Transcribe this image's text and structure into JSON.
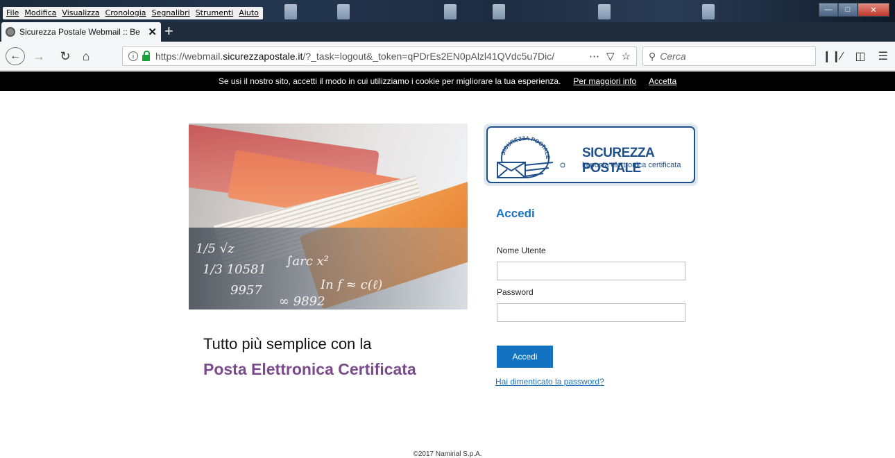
{
  "browser": {
    "menu": [
      "File",
      "Modifica",
      "Visualizza",
      "Cronologia",
      "Segnalibri",
      "Strumenti",
      "Aiuto"
    ],
    "tab_title": "Sicurezza Postale Webmail :: Be",
    "url_prefix": "https://webmail.",
    "url_domain": "sicurezzapostale.it",
    "url_rest": "/?_task=logout&_token=qPDrEs2EN0pAlzl41QVdc5u7Dic/",
    "search_placeholder": "Cerca"
  },
  "cookie": {
    "text": "Se usi il nostro sito, accetti il modo in cui utilizziamo i cookie per migliorare la tua esperienza.",
    "more_link": "Per maggiori info",
    "accept_link": "Accetta"
  },
  "hero": {
    "tagline_line1": "Tutto più semplice con la",
    "tagline_line2": "Posta Elettronica Certificata"
  },
  "logo": {
    "seal_text": "SICUREZZA POSTALE",
    "title": "SICUREZZA POSTALE",
    "subtitle": "la posta elettronica certificata"
  },
  "login": {
    "title": "Accedi",
    "username_label": "Nome Utente",
    "username_value": "",
    "password_label": "Password",
    "password_value": "",
    "submit_label": "Accedi",
    "forgot_link": "Hai dimenticato la password?"
  },
  "footer": {
    "copyright": "©2017 Namirial S.p.A."
  }
}
